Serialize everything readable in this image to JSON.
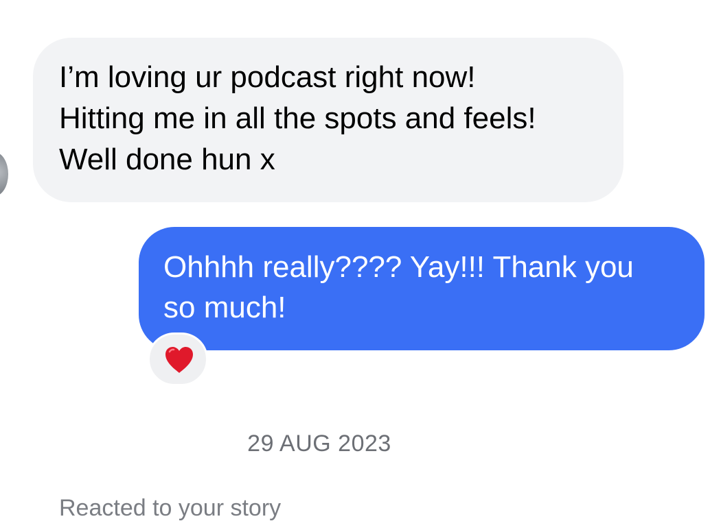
{
  "messages": {
    "incoming": {
      "text": "I’m loving ur podcast right now!\nHitting me in all the spots and feels!\nWell done hun x"
    },
    "outgoing": {
      "text": "Ohhhh really???? Yay!!! Thank you\nso much!",
      "reaction_icon": "red-heart-icon"
    }
  },
  "date_separator": "29 AUG 2023",
  "story_note": "Reacted to your story",
  "colors": {
    "incoming_bubble": "#f2f3f5",
    "outgoing_bubble": "#3a6ff5",
    "reaction_heart": "#e0192b",
    "meta_text": "#6c6f75"
  }
}
